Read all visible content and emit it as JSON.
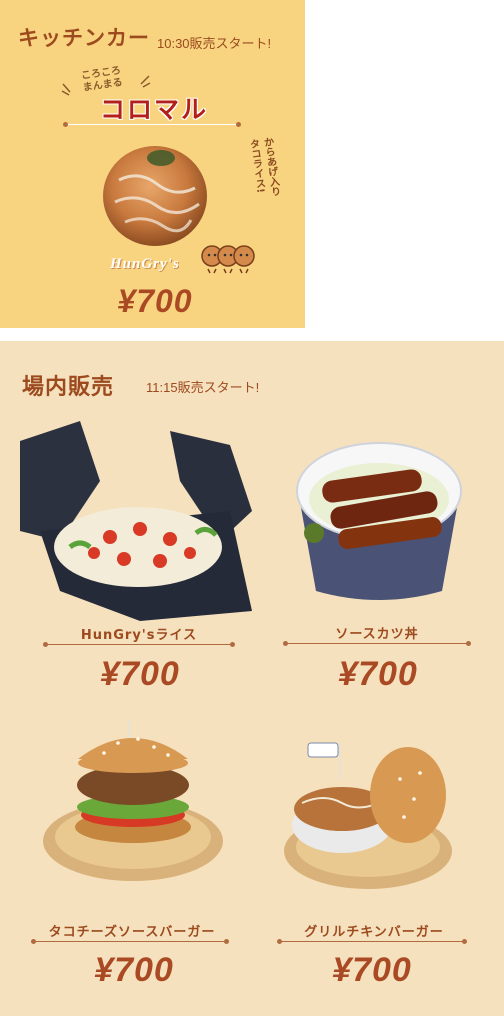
{
  "kitchen": {
    "title": "キッチンカー",
    "start": "10:30販売スタート!",
    "tagline": "ころころ\nまんまる",
    "product": "コロマル",
    "note": "からあげ入り\nタコライス!",
    "brand": "HunGry's",
    "price": "¥700"
  },
  "venue": {
    "title": "場内販売",
    "start": "11:15販売スタート!",
    "items": [
      {
        "name": "HunGry'sライス",
        "price": "¥700"
      },
      {
        "name": "ソースカツ丼",
        "price": "¥700"
      },
      {
        "name": "タコチーズソースバーガー",
        "price": "¥700"
      },
      {
        "name": "グリルチキンバーガー",
        "price": "¥700"
      }
    ]
  }
}
